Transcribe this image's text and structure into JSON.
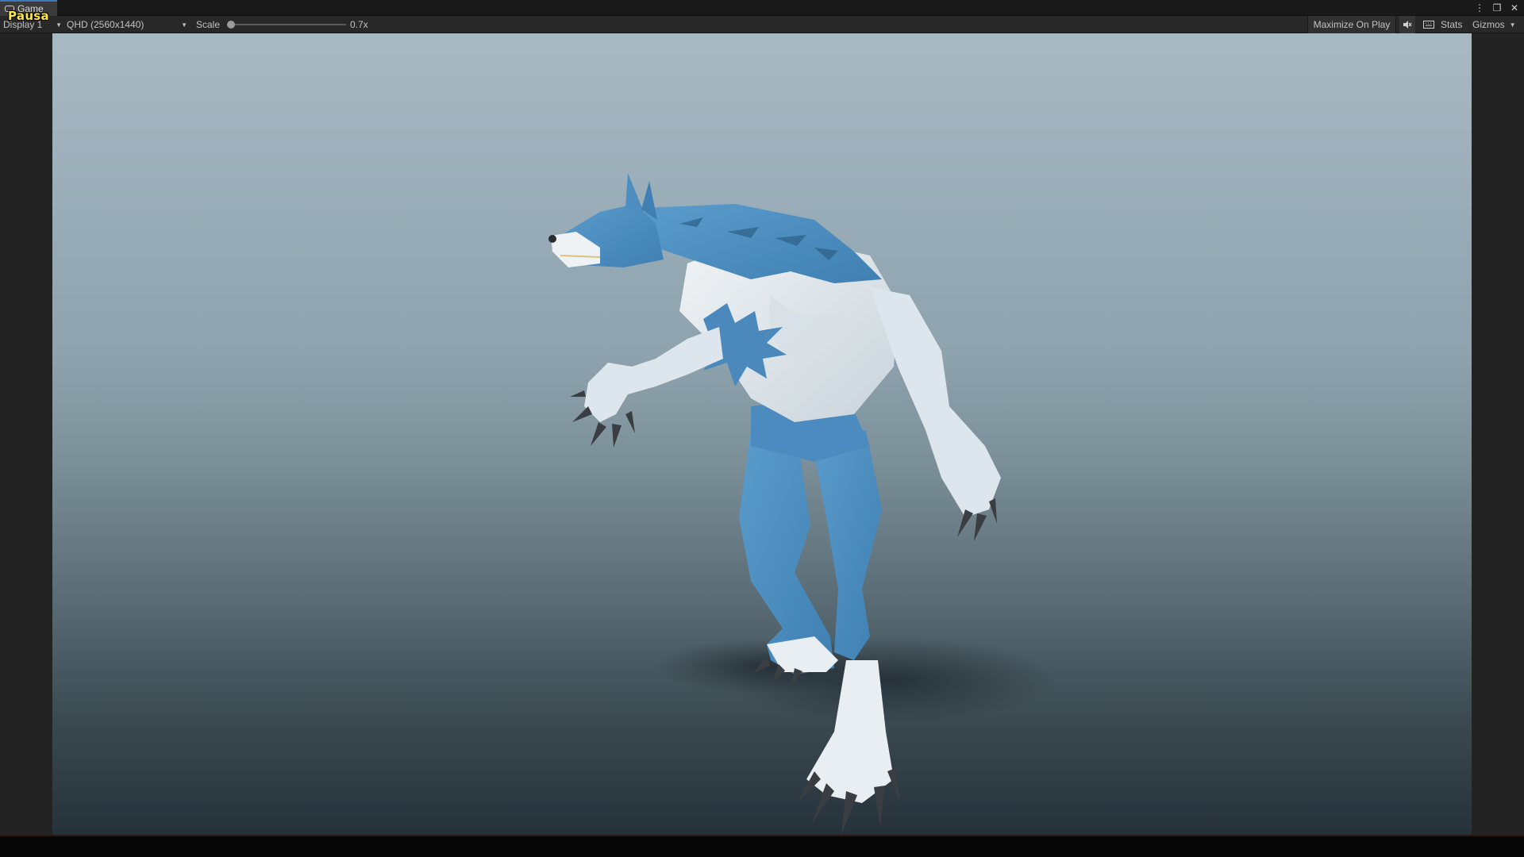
{
  "tab": {
    "label": "Game",
    "icon": "gamepad-icon"
  },
  "overlay": {
    "pause_text": "Pausa",
    "color": "#ffe640"
  },
  "toolbar": {
    "display": "Display 1",
    "resolution": "QHD (2560x1440)",
    "scale_label": "Scale",
    "scale_value": "0.7x",
    "scale_fraction": 0.0,
    "maximize": "Maximize On Play",
    "stats": "Stats",
    "gizmos": "Gizmos"
  },
  "window_controls": [
    "more-icon",
    "restore-icon",
    "close-icon"
  ],
  "colors": {
    "accent": "#3a79bb",
    "fur_blue": "#4a8fc4",
    "fur_white": "#e6ecf0"
  }
}
